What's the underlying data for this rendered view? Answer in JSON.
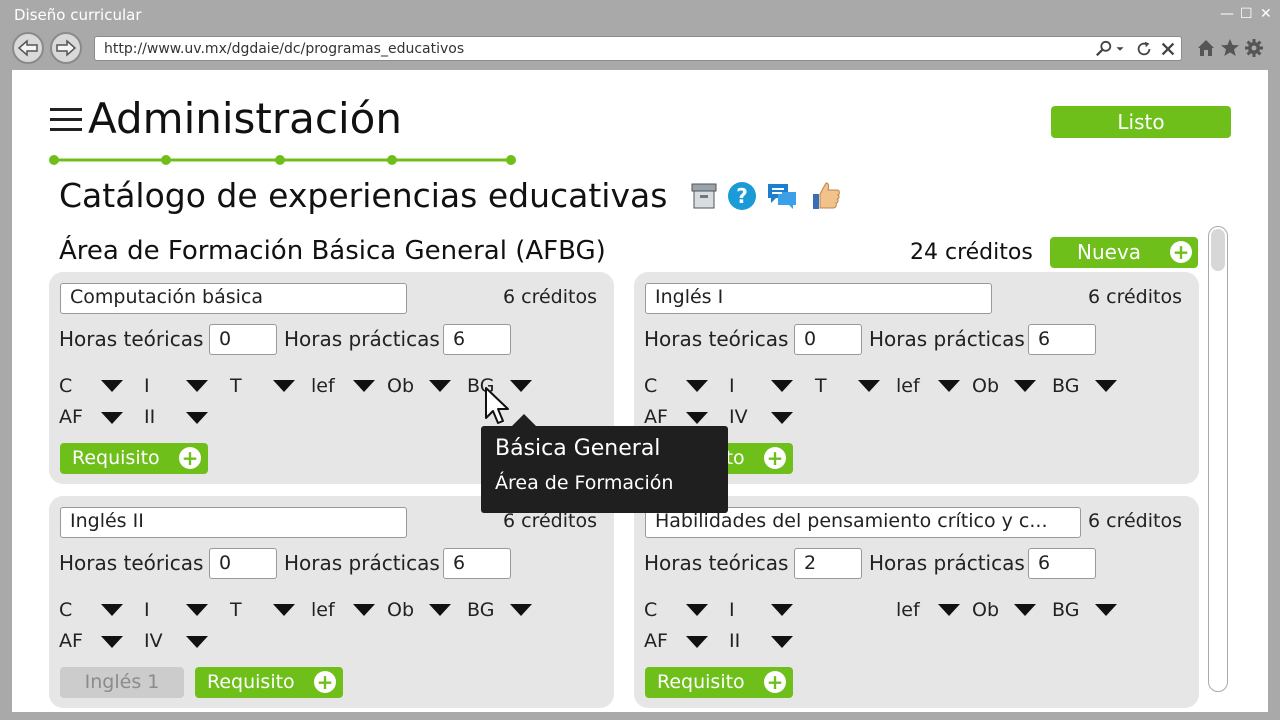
{
  "window": {
    "title": "Diseño curricular",
    "min": "—",
    "max": "☐",
    "close": "✕"
  },
  "browser": {
    "url": "http://www.uv.mx/dgdaie/dc/programas_educativos"
  },
  "header": {
    "title": "Administración",
    "listo_label": "Listo"
  },
  "section": {
    "title": "Catálogo de experiencias educativas"
  },
  "area": {
    "title": "Área de Formación Básica General (AFBG)",
    "credits": "24 créditos",
    "nueva_label": "Nueva"
  },
  "labels": {
    "horas_teoricas": "Horas teóricas",
    "horas_practicas": "Horas prácticas",
    "requisito": "Requisito"
  },
  "cards": [
    {
      "name": "Computación básica",
      "credits": "6 créditos",
      "ht": "0",
      "hp": "6",
      "s1": [
        "C",
        "I",
        "T",
        "lef",
        "Ob",
        "BG"
      ],
      "s2": [
        "AF",
        "II"
      ]
    },
    {
      "name": "Inglés I",
      "credits": "6 créditos",
      "ht": "0",
      "hp": "6",
      "s1": [
        "C",
        "I",
        "T",
        "lef",
        "Ob",
        "BG"
      ],
      "s2": [
        "AF",
        "IV"
      ]
    },
    {
      "name": "Inglés II",
      "credits": "6 créditos",
      "ht": "0",
      "hp": "6",
      "s1": [
        "C",
        "I",
        "T",
        "lef",
        "Ob",
        "BG"
      ],
      "s2": [
        "AF",
        "IV"
      ],
      "tag": "Inglés 1"
    },
    {
      "name": "Habilidades del pensamiento crítico y c...",
      "credits": "6 créditos",
      "ht": "2",
      "hp": "6",
      "s1": [
        "C",
        "I",
        "",
        "lef",
        "Ob",
        "BG"
      ],
      "s2": [
        "AF",
        "II"
      ]
    }
  ],
  "tooltip": {
    "line1": "Básica General",
    "line2": "Área de Formación"
  },
  "icons": {
    "back": "back-arrow-icon",
    "forward": "forward-arrow-icon",
    "search": "search-icon",
    "refresh": "refresh-icon",
    "stop": "close-icon",
    "home": "home-icon",
    "favorite": "star-icon",
    "settings": "gear-icon",
    "menu": "hamburger-menu-icon",
    "archive": "archive-box-icon",
    "help": "help-icon",
    "chat": "chat-icon",
    "like": "thumbs-up-icon"
  },
  "colors": {
    "accent": "#6fbf1a",
    "card": "#e6e6e6",
    "tooltip": "#1f1f1f",
    "help_blue": "#1a9ad6"
  }
}
